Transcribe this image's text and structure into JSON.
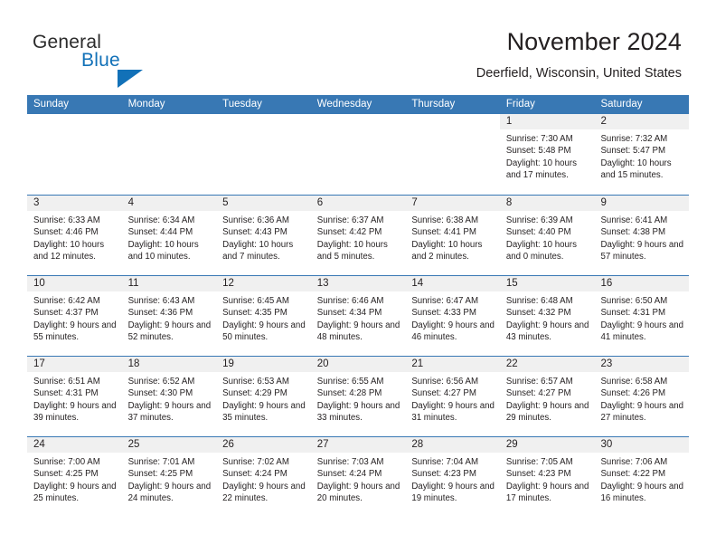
{
  "brand": {
    "word_one": "General",
    "word_two": "Blue",
    "accent_color": "#1271b8"
  },
  "header": {
    "title": "November 2024",
    "subtitle": "Deerfield, Wisconsin, United States"
  },
  "theme": {
    "header_row_bg": "#3878b4",
    "day_strip_bg": "#f0f0f0",
    "text_color": "#231f20"
  },
  "weekdays": [
    "Sunday",
    "Monday",
    "Tuesday",
    "Wednesday",
    "Thursday",
    "Friday",
    "Saturday"
  ],
  "weeks": [
    [
      {
        "day": "",
        "sunrise": "",
        "sunset": "",
        "daylight": ""
      },
      {
        "day": "",
        "sunrise": "",
        "sunset": "",
        "daylight": ""
      },
      {
        "day": "",
        "sunrise": "",
        "sunset": "",
        "daylight": ""
      },
      {
        "day": "",
        "sunrise": "",
        "sunset": "",
        "daylight": ""
      },
      {
        "day": "",
        "sunrise": "",
        "sunset": "",
        "daylight": ""
      },
      {
        "day": "1",
        "sunrise": "Sunrise: 7:30 AM",
        "sunset": "Sunset: 5:48 PM",
        "daylight": "Daylight: 10 hours and 17 minutes."
      },
      {
        "day": "2",
        "sunrise": "Sunrise: 7:32 AM",
        "sunset": "Sunset: 5:47 PM",
        "daylight": "Daylight: 10 hours and 15 minutes."
      }
    ],
    [
      {
        "day": "3",
        "sunrise": "Sunrise: 6:33 AM",
        "sunset": "Sunset: 4:46 PM",
        "daylight": "Daylight: 10 hours and 12 minutes."
      },
      {
        "day": "4",
        "sunrise": "Sunrise: 6:34 AM",
        "sunset": "Sunset: 4:44 PM",
        "daylight": "Daylight: 10 hours and 10 minutes."
      },
      {
        "day": "5",
        "sunrise": "Sunrise: 6:36 AM",
        "sunset": "Sunset: 4:43 PM",
        "daylight": "Daylight: 10 hours and 7 minutes."
      },
      {
        "day": "6",
        "sunrise": "Sunrise: 6:37 AM",
        "sunset": "Sunset: 4:42 PM",
        "daylight": "Daylight: 10 hours and 5 minutes."
      },
      {
        "day": "7",
        "sunrise": "Sunrise: 6:38 AM",
        "sunset": "Sunset: 4:41 PM",
        "daylight": "Daylight: 10 hours and 2 minutes."
      },
      {
        "day": "8",
        "sunrise": "Sunrise: 6:39 AM",
        "sunset": "Sunset: 4:40 PM",
        "daylight": "Daylight: 10 hours and 0 minutes."
      },
      {
        "day": "9",
        "sunrise": "Sunrise: 6:41 AM",
        "sunset": "Sunset: 4:38 PM",
        "daylight": "Daylight: 9 hours and 57 minutes."
      }
    ],
    [
      {
        "day": "10",
        "sunrise": "Sunrise: 6:42 AM",
        "sunset": "Sunset: 4:37 PM",
        "daylight": "Daylight: 9 hours and 55 minutes."
      },
      {
        "day": "11",
        "sunrise": "Sunrise: 6:43 AM",
        "sunset": "Sunset: 4:36 PM",
        "daylight": "Daylight: 9 hours and 52 minutes."
      },
      {
        "day": "12",
        "sunrise": "Sunrise: 6:45 AM",
        "sunset": "Sunset: 4:35 PM",
        "daylight": "Daylight: 9 hours and 50 minutes."
      },
      {
        "day": "13",
        "sunrise": "Sunrise: 6:46 AM",
        "sunset": "Sunset: 4:34 PM",
        "daylight": "Daylight: 9 hours and 48 minutes."
      },
      {
        "day": "14",
        "sunrise": "Sunrise: 6:47 AM",
        "sunset": "Sunset: 4:33 PM",
        "daylight": "Daylight: 9 hours and 46 minutes."
      },
      {
        "day": "15",
        "sunrise": "Sunrise: 6:48 AM",
        "sunset": "Sunset: 4:32 PM",
        "daylight": "Daylight: 9 hours and 43 minutes."
      },
      {
        "day": "16",
        "sunrise": "Sunrise: 6:50 AM",
        "sunset": "Sunset: 4:31 PM",
        "daylight": "Daylight: 9 hours and 41 minutes."
      }
    ],
    [
      {
        "day": "17",
        "sunrise": "Sunrise: 6:51 AM",
        "sunset": "Sunset: 4:31 PM",
        "daylight": "Daylight: 9 hours and 39 minutes."
      },
      {
        "day": "18",
        "sunrise": "Sunrise: 6:52 AM",
        "sunset": "Sunset: 4:30 PM",
        "daylight": "Daylight: 9 hours and 37 minutes."
      },
      {
        "day": "19",
        "sunrise": "Sunrise: 6:53 AM",
        "sunset": "Sunset: 4:29 PM",
        "daylight": "Daylight: 9 hours and 35 minutes."
      },
      {
        "day": "20",
        "sunrise": "Sunrise: 6:55 AM",
        "sunset": "Sunset: 4:28 PM",
        "daylight": "Daylight: 9 hours and 33 minutes."
      },
      {
        "day": "21",
        "sunrise": "Sunrise: 6:56 AM",
        "sunset": "Sunset: 4:27 PM",
        "daylight": "Daylight: 9 hours and 31 minutes."
      },
      {
        "day": "22",
        "sunrise": "Sunrise: 6:57 AM",
        "sunset": "Sunset: 4:27 PM",
        "daylight": "Daylight: 9 hours and 29 minutes."
      },
      {
        "day": "23",
        "sunrise": "Sunrise: 6:58 AM",
        "sunset": "Sunset: 4:26 PM",
        "daylight": "Daylight: 9 hours and 27 minutes."
      }
    ],
    [
      {
        "day": "24",
        "sunrise": "Sunrise: 7:00 AM",
        "sunset": "Sunset: 4:25 PM",
        "daylight": "Daylight: 9 hours and 25 minutes."
      },
      {
        "day": "25",
        "sunrise": "Sunrise: 7:01 AM",
        "sunset": "Sunset: 4:25 PM",
        "daylight": "Daylight: 9 hours and 24 minutes."
      },
      {
        "day": "26",
        "sunrise": "Sunrise: 7:02 AM",
        "sunset": "Sunset: 4:24 PM",
        "daylight": "Daylight: 9 hours and 22 minutes."
      },
      {
        "day": "27",
        "sunrise": "Sunrise: 7:03 AM",
        "sunset": "Sunset: 4:24 PM",
        "daylight": "Daylight: 9 hours and 20 minutes."
      },
      {
        "day": "28",
        "sunrise": "Sunrise: 7:04 AM",
        "sunset": "Sunset: 4:23 PM",
        "daylight": "Daylight: 9 hours and 19 minutes."
      },
      {
        "day": "29",
        "sunrise": "Sunrise: 7:05 AM",
        "sunset": "Sunset: 4:23 PM",
        "daylight": "Daylight: 9 hours and 17 minutes."
      },
      {
        "day": "30",
        "sunrise": "Sunrise: 7:06 AM",
        "sunset": "Sunset: 4:22 PM",
        "daylight": "Daylight: 9 hours and 16 minutes."
      }
    ]
  ]
}
